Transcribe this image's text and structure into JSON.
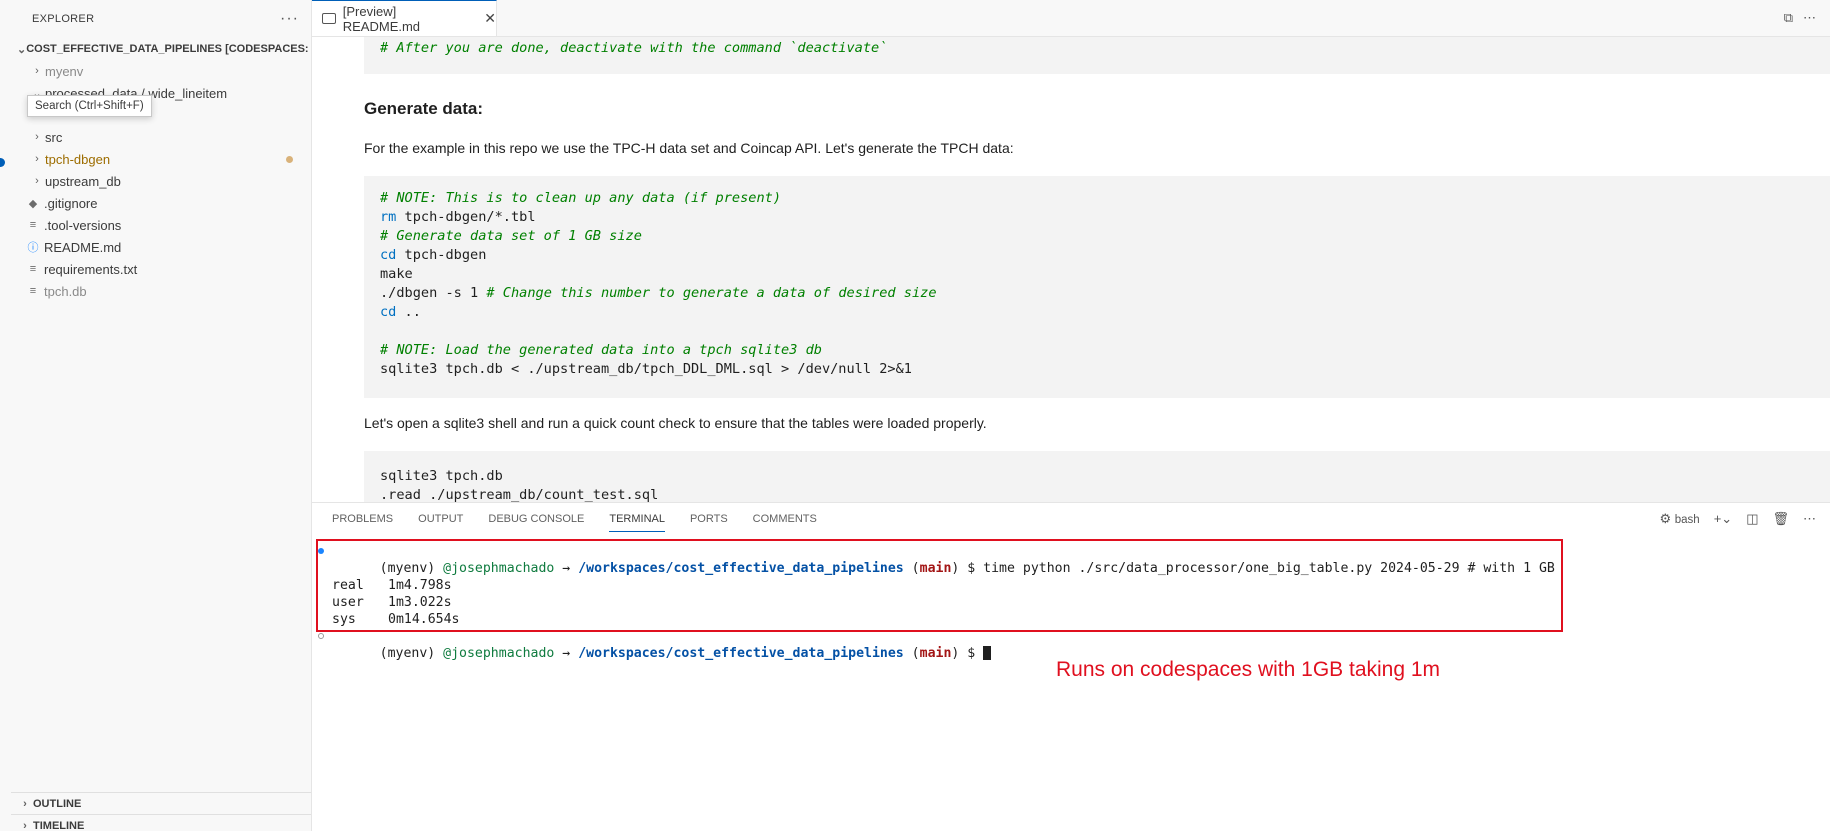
{
  "sidebar": {
    "header": "EXPLORER",
    "more": "···",
    "workspace": "COST_EFFECTIVE_DATA_PIPELINES [CODESPACES: URBA...",
    "tooltip": "Search (Ctrl+Shift+F)",
    "items": [
      {
        "label": "myenv",
        "type": "folder"
      },
      {
        "label": "processed_data / wide_lineitem",
        "type": "folder"
      },
      {
        "label": "src",
        "type": "folder"
      },
      {
        "label": "tpch-dbgen",
        "type": "folder"
      },
      {
        "label": "upstream_db",
        "type": "folder"
      },
      {
        "label": ".gitignore",
        "type": "file"
      },
      {
        "label": ".tool-versions",
        "type": "file"
      },
      {
        "label": "README.md",
        "type": "file"
      },
      {
        "label": "requirements.txt",
        "type": "file"
      },
      {
        "label": "tpch.db",
        "type": "file"
      }
    ],
    "outline": "OUTLINE",
    "timeline": "TIMELINE"
  },
  "editor": {
    "tab_title": "[Preview] README.md"
  },
  "preview": {
    "top_code": "# After you are done, deactivate with the command `deactivate`",
    "heading": "Generate data:",
    "para1": "For the example in this repo we use the TPC-H data set and Coincap API. Let's generate the TPCH data:",
    "code1": [
      "# NOTE: This is to clean up any data (if present)",
      "rm tpch-dbgen/*.tbl",
      "# Generate data set of 1 GB size",
      "cd tpch-dbgen",
      "make",
      "./dbgen -s 1 # Change this number to generate a data of desired size",
      "cd ..",
      "",
      "# NOTE: Load the generated data into a tpch sqlite3 db",
      "sqlite3 tpch.db < ./upstream_db/tpch_DDL_DML.sql > /dev/null 2>&1"
    ],
    "para2": "Let's open a sqlite3 shell and run a quick count check to ensure that the tables were loaded properly.",
    "code2": [
      "sqlite3 tpch.db",
      ".read ./upstream_db/count_test.sql"
    ]
  },
  "panel": {
    "tabs": [
      "PROBLEMS",
      "OUTPUT",
      "DEBUG CONSOLE",
      "TERMINAL",
      "PORTS",
      "COMMENTS"
    ],
    "active_tab": "TERMINAL",
    "shell": "bash",
    "terminal": {
      "env": "(myenv)",
      "user": "@josephmachado",
      "arrow": "→",
      "path": "/workspaces/cost_effective_data_pipelines",
      "branch_open": "(",
      "branch": "main",
      "branch_close": ")",
      "command": "$ time python ./src/data_processor/one_big_table.py 2024-05-29 # with 1 GB",
      "real_label": "real",
      "real_value": "1m4.798s",
      "user_label": "user",
      "user_value": "1m3.022s",
      "sys_label": "sys",
      "sys_value": "0m14.654s",
      "prompt_end": "$"
    },
    "annotation": "Runs on codespaces with 1GB taking 1m"
  },
  "colors": {
    "accent": "#005fb8",
    "annotation_red": "#e0101f"
  }
}
